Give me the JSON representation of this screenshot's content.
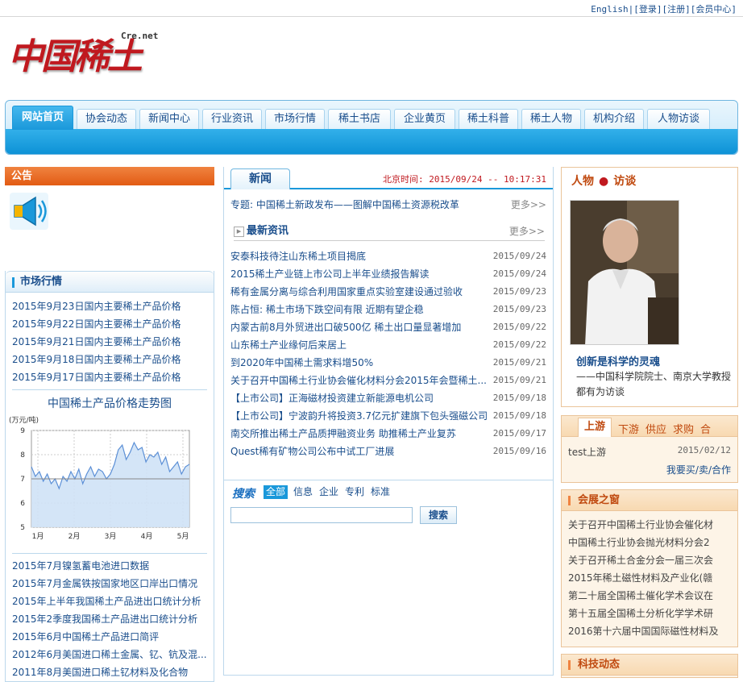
{
  "top": {
    "english": "English",
    "login": "[登录]",
    "register": "[注册]",
    "member": "[会员中心]"
  },
  "logo": {
    "cn": "中国稀土",
    "en": "Cre.net"
  },
  "nav": [
    "网站首页",
    "协会动态",
    "新闻中心",
    "行业资讯",
    "市场行情",
    "稀土书店",
    "企业黄页",
    "稀土科普",
    "稀土人物",
    "机构介绍",
    "人物访谈"
  ],
  "notice": {
    "title": "公告"
  },
  "market": {
    "title": "市场行情",
    "items": [
      "2015年9月23日国内主要稀土产品价格",
      "2015年9月22日国内主要稀土产品价格",
      "2015年9月21日国内主要稀土产品价格",
      "2015年9月18日国内主要稀土产品价格",
      "2015年9月17日国内主要稀土产品价格"
    ],
    "items2": [
      "2015年7月镍氢蓄电池进口数据",
      "2015年7月金属铁按国家地区口岸出口情况",
      "2015年上半年我国稀土产品进出口统计分析",
      "2015年2季度我国稀土产品进出口统计分析",
      "2015年6月中国稀土产品进口简评",
      "2012年6月美国进口稀土金属、钇、钪及混...",
      "2011年8月美国进口稀土钇材料及化合物"
    ]
  },
  "chart_data": {
    "type": "line",
    "title": "中国稀土产品价格走势图",
    "ylabel": "(万元/吨)",
    "x_ticks": [
      "1月",
      "2月",
      "3月",
      "4月",
      "5月"
    ],
    "y_ticks": [
      "9",
      "8",
      "7",
      "6",
      "5"
    ],
    "ylim": [
      5,
      9
    ],
    "reference_line": 7,
    "values": [
      7.5,
      7.1,
      7.3,
      6.9,
      7.2,
      6.8,
      7.0,
      6.6,
      7.1,
      6.9,
      7.3,
      7.0,
      7.4,
      6.8,
      7.2,
      7.5,
      7.1,
      7.4,
      7.3,
      7.0,
      7.2,
      7.6,
      8.2,
      8.4,
      7.8,
      8.1,
      8.5,
      8.2,
      8.3,
      7.7,
      8.0,
      7.9,
      8.1,
      7.6,
      7.9,
      7.3,
      7.5,
      7.7,
      7.2,
      7.5,
      7.6
    ],
    "grid": true
  },
  "news": {
    "tab": "新闻",
    "time": "北京时间: 2015/09/24 -- 10:17:31",
    "topic": "专题: 中国稀土新政发布——图解中国稀土资源税改革",
    "more": "更多>>",
    "latest": "最新资讯",
    "rows": [
      {
        "t": "安泰科技待注山东稀土项目揭底",
        "d": "2015/09/24"
      },
      {
        "t": "2015稀土产业链上市公司上半年业绩报告解读",
        "d": "2015/09/24"
      },
      {
        "t": "稀有金属分离与综合利用国家重点实验室建设通过验收",
        "d": "2015/09/23"
      },
      {
        "t": "陈占恒: 稀土市场下跌空间有限 近期有望企稳",
        "d": "2015/09/23"
      },
      {
        "t": "内蒙古前8月外贸进出口破500亿 稀土出口量显著增加",
        "d": "2015/09/22"
      },
      {
        "t": "山东稀土产业缘何后来居上",
        "d": "2015/09/22"
      },
      {
        "t": "到2020年中国稀土需求料增50%",
        "d": "2015/09/21"
      },
      {
        "t": "关于召开中国稀土行业协会催化材料分会2015年会暨稀土...",
        "d": "2015/09/21"
      },
      {
        "t": "【上市公司】正海磁材投资建立新能源电机公司",
        "d": "2015/09/18"
      },
      {
        "t": "【上市公司】宁波韵升将投资3.7亿元扩建旗下包头强磁公司",
        "d": "2015/09/18"
      },
      {
        "t": "南交所推出稀土产品质押融资业务 助推稀土产业复苏",
        "d": "2015/09/17"
      },
      {
        "t": "Quest稀有矿物公司公布中试工厂进展",
        "d": "2015/09/16"
      }
    ]
  },
  "search": {
    "label": "搜索",
    "tabs": [
      "全部",
      "信息",
      "企业",
      "专利",
      "标准"
    ],
    "button": "搜索",
    "placeholder": ""
  },
  "person": {
    "title1": "人物",
    "title2": "访谈",
    "headline": "创新是科学的灵魂",
    "desc": "——中国科学院院士、南京大学教授都有为访谈"
  },
  "trade": {
    "tabs": [
      "上游",
      "下游",
      "供应",
      "求购",
      "合"
    ],
    "item": "test上游",
    "date": "2015/02/12",
    "link": "我要买/卖/合作"
  },
  "expo": {
    "title": "会展之窗",
    "items": [
      "关于召开中国稀土行业协会催化材",
      "中国稀土行业协会抛光材料分会2",
      "关于召开稀土合金分会一届三次会",
      "2015年稀土磁性材料及产业化(赣",
      "第二十届全国稀土催化学术会议在",
      "第十五届全国稀土分析化学学术研",
      "2016第十六届中国国际磁性材料及"
    ]
  },
  "tech": {
    "title": "科技动态"
  }
}
